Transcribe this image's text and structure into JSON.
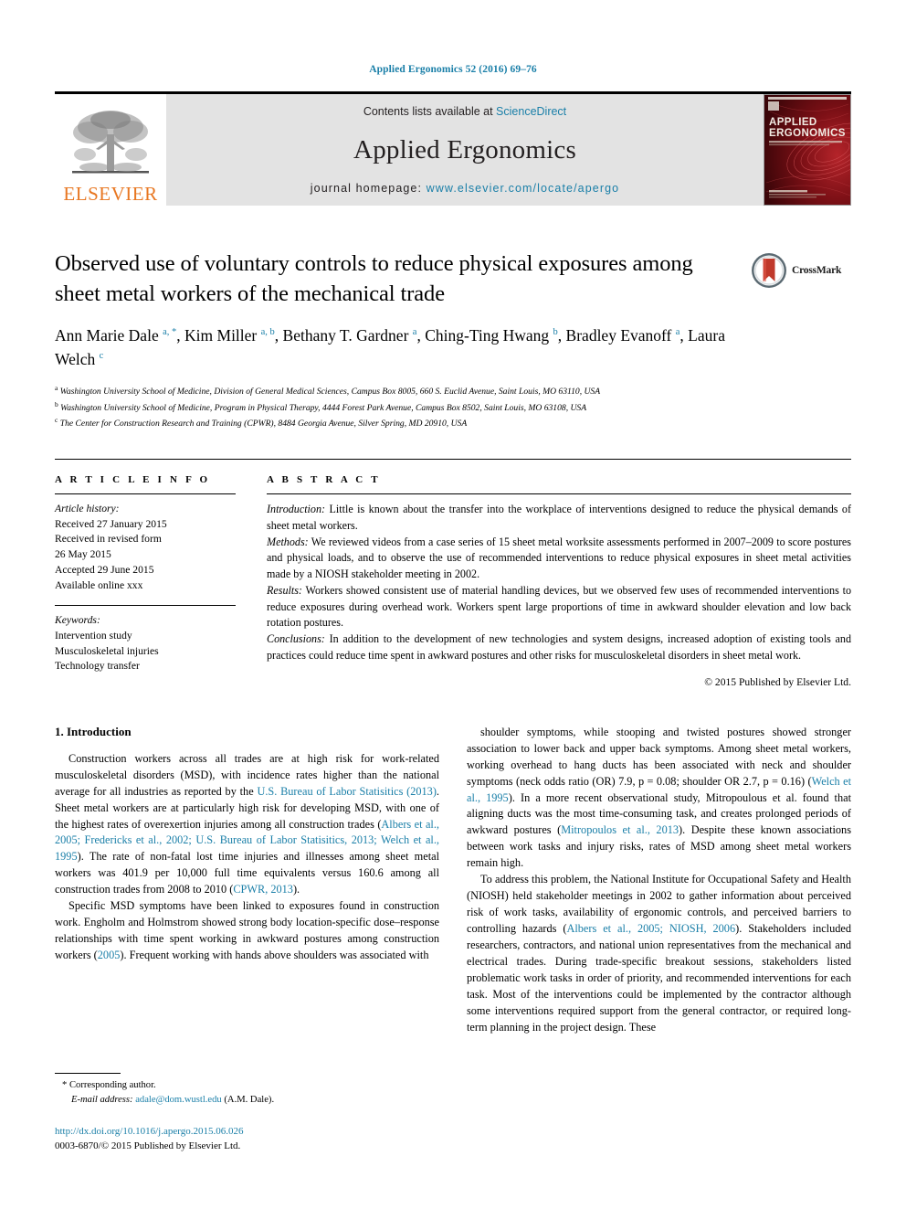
{
  "running_head": "Applied Ergonomics 52 (2016) 69–76",
  "masthead": {
    "contents_prefix": "Contents lists available at ",
    "contents_link": "ScienceDirect",
    "journal_title": "Applied Ergonomics",
    "homepage_prefix": "journal homepage: ",
    "homepage_link": "www.elsevier.com/locate/apergo",
    "publisher_wordmark": "ELSEVIER",
    "cover_title_line1": "APPLIED",
    "cover_title_line2": "ERGONOMICS"
  },
  "article": {
    "title": "Observed use of voluntary controls to reduce physical exposures among sheet metal workers of the mechanical trade",
    "crossmark_label": "CrossMark",
    "authors_html": "Ann Marie Dale <sup>a, *</sup>, Kim Miller <sup>a, b</sup>, Bethany T. Gardner <sup>a</sup>, Ching-Ting Hwang <sup>b</sup>, Bradley Evanoff <sup>a</sup>, Laura Welch <sup>c</sup>",
    "affiliations": [
      {
        "marker": "a",
        "text": "Washington University School of Medicine, Division of General Medical Sciences, Campus Box 8005, 660 S. Euclid Avenue, Saint Louis, MO 63110, USA"
      },
      {
        "marker": "b",
        "text": "Washington University School of Medicine, Program in Physical Therapy, 4444 Forest Park Avenue, Campus Box 8502, Saint Louis, MO 63108, USA"
      },
      {
        "marker": "c",
        "text": "The Center for Construction Research and Training (CPWR), 8484 Georgia Avenue, Silver Spring, MD 20910, USA"
      }
    ]
  },
  "article_info": {
    "heading": "A R T I C L E  I N F O",
    "history_label": "Article history:",
    "history_lines": [
      "Received 27 January 2015",
      "Received in revised form",
      "26 May 2015",
      "Accepted 29 June 2015",
      "Available online xxx"
    ],
    "keywords_label": "Keywords:",
    "keywords": [
      "Intervention study",
      "Musculoskeletal injuries",
      "Technology transfer"
    ]
  },
  "abstract": {
    "heading": "A B S T R A C T",
    "sections": [
      {
        "lead": "Introduction:",
        "text": " Little is known about the transfer into the workplace of interventions designed to reduce the physical demands of sheet metal workers."
      },
      {
        "lead": "Methods:",
        "text": " We reviewed videos from a case series of 15 sheet metal worksite assessments performed in 2007–2009 to score postures and physical loads, and to observe the use of recommended interventions to reduce physical exposures in sheet metal activities made by a NIOSH stakeholder meeting in 2002."
      },
      {
        "lead": "Results:",
        "text": " Workers showed consistent use of material handling devices, but we observed few uses of recommended interventions to reduce exposures during overhead work. Workers spent large proportions of time in awkward shoulder elevation and low back rotation postures."
      },
      {
        "lead": "Conclusions:",
        "text": " In addition to the development of new technologies and system designs, increased adoption of existing tools and practices could reduce time spent in awkward postures and other risks for musculoskeletal disorders in sheet metal work."
      }
    ],
    "copyright": "© 2015 Published by Elsevier Ltd."
  },
  "body": {
    "section_number_title": "1. Introduction",
    "left_paragraphs": [
      "Construction workers across all trades are at high risk for work-related musculoskeletal disorders (MSD), with incidence rates higher than the national average for all industries as reported by the <span class=\"ref\">U.S. Bureau of Labor Statisitics (2013)</span>. Sheet metal workers are at particularly high risk for developing MSD, with one of the highest rates of overexertion injuries among all construction trades (<span class=\"ref\">Albers et al., 2005; Fredericks et al., 2002; U.S. Bureau of Labor Statisitics, 2013; Welch et al., 1995</span>). The rate of non-fatal lost time injuries and illnesses among sheet metal workers was 401.9 per 10,000 full time equivalents versus 160.6 among all construction trades from 2008 to 2010 (<span class=\"ref\">CPWR, 2013</span>).",
      "Specific MSD symptoms have been linked to exposures found in construction work. Engholm and Holmstrom showed strong body location-specific dose–response relationships with time spent working in awkward postures among construction workers (<span class=\"ref\">2005</span>). Frequent working with hands above shoulders was associated with"
    ],
    "right_paragraphs": [
      "shoulder symptoms, while stooping and twisted postures showed stronger association to lower back and upper back symptoms. Among sheet metal workers, working overhead to hang ducts has been associated with neck and shoulder symptoms (neck odds ratio (OR) 7.9, p = 0.08; shoulder OR 2.7, p = 0.16) (<span class=\"ref\">Welch et al., 1995</span>). In a more recent observational study, Mitropoulous et al. found that aligning ducts was the most time-consuming task, and creates prolonged periods of awkward postures (<span class=\"ref\">Mitropoulos et al., 2013</span>). Despite these known associations between work tasks and injury risks, rates of MSD among sheet metal workers remain high.",
      "To address this problem, the National Institute for Occupational Safety and Health (NIOSH) held stakeholder meetings in 2002 to gather information about perceived risk of work tasks, availability of ergonomic controls, and perceived barriers to controlling hazards (<span class=\"ref\">Albers et al., 2005; NIOSH, 2006</span>). Stakeholders included researchers, contractors, and national union representatives from the mechanical and electrical trades. During trade-specific breakout sessions, stakeholders listed problematic work tasks in order of priority, and recommended interventions for each task. Most of the interventions could be implemented by the contractor although some interventions required support from the general contractor, or required long-term planning in the project design. These"
    ]
  },
  "footer": {
    "corresponding_marker": "*",
    "corresponding_label": "Corresponding author.",
    "email_label": "E-mail address:",
    "email": "adale@dom.wustl.edu",
    "email_attribution": "(A.M. Dale).",
    "doi": "http://dx.doi.org/10.1016/j.apergo.2015.06.026",
    "issn_line": "0003-6870/© 2015 Published by Elsevier Ltd."
  },
  "colors": {
    "link": "#1a7fa8",
    "elsevier_orange": "#e87722",
    "masthead_gray": "#e3e3e3",
    "cover_red": "#8c1118"
  }
}
